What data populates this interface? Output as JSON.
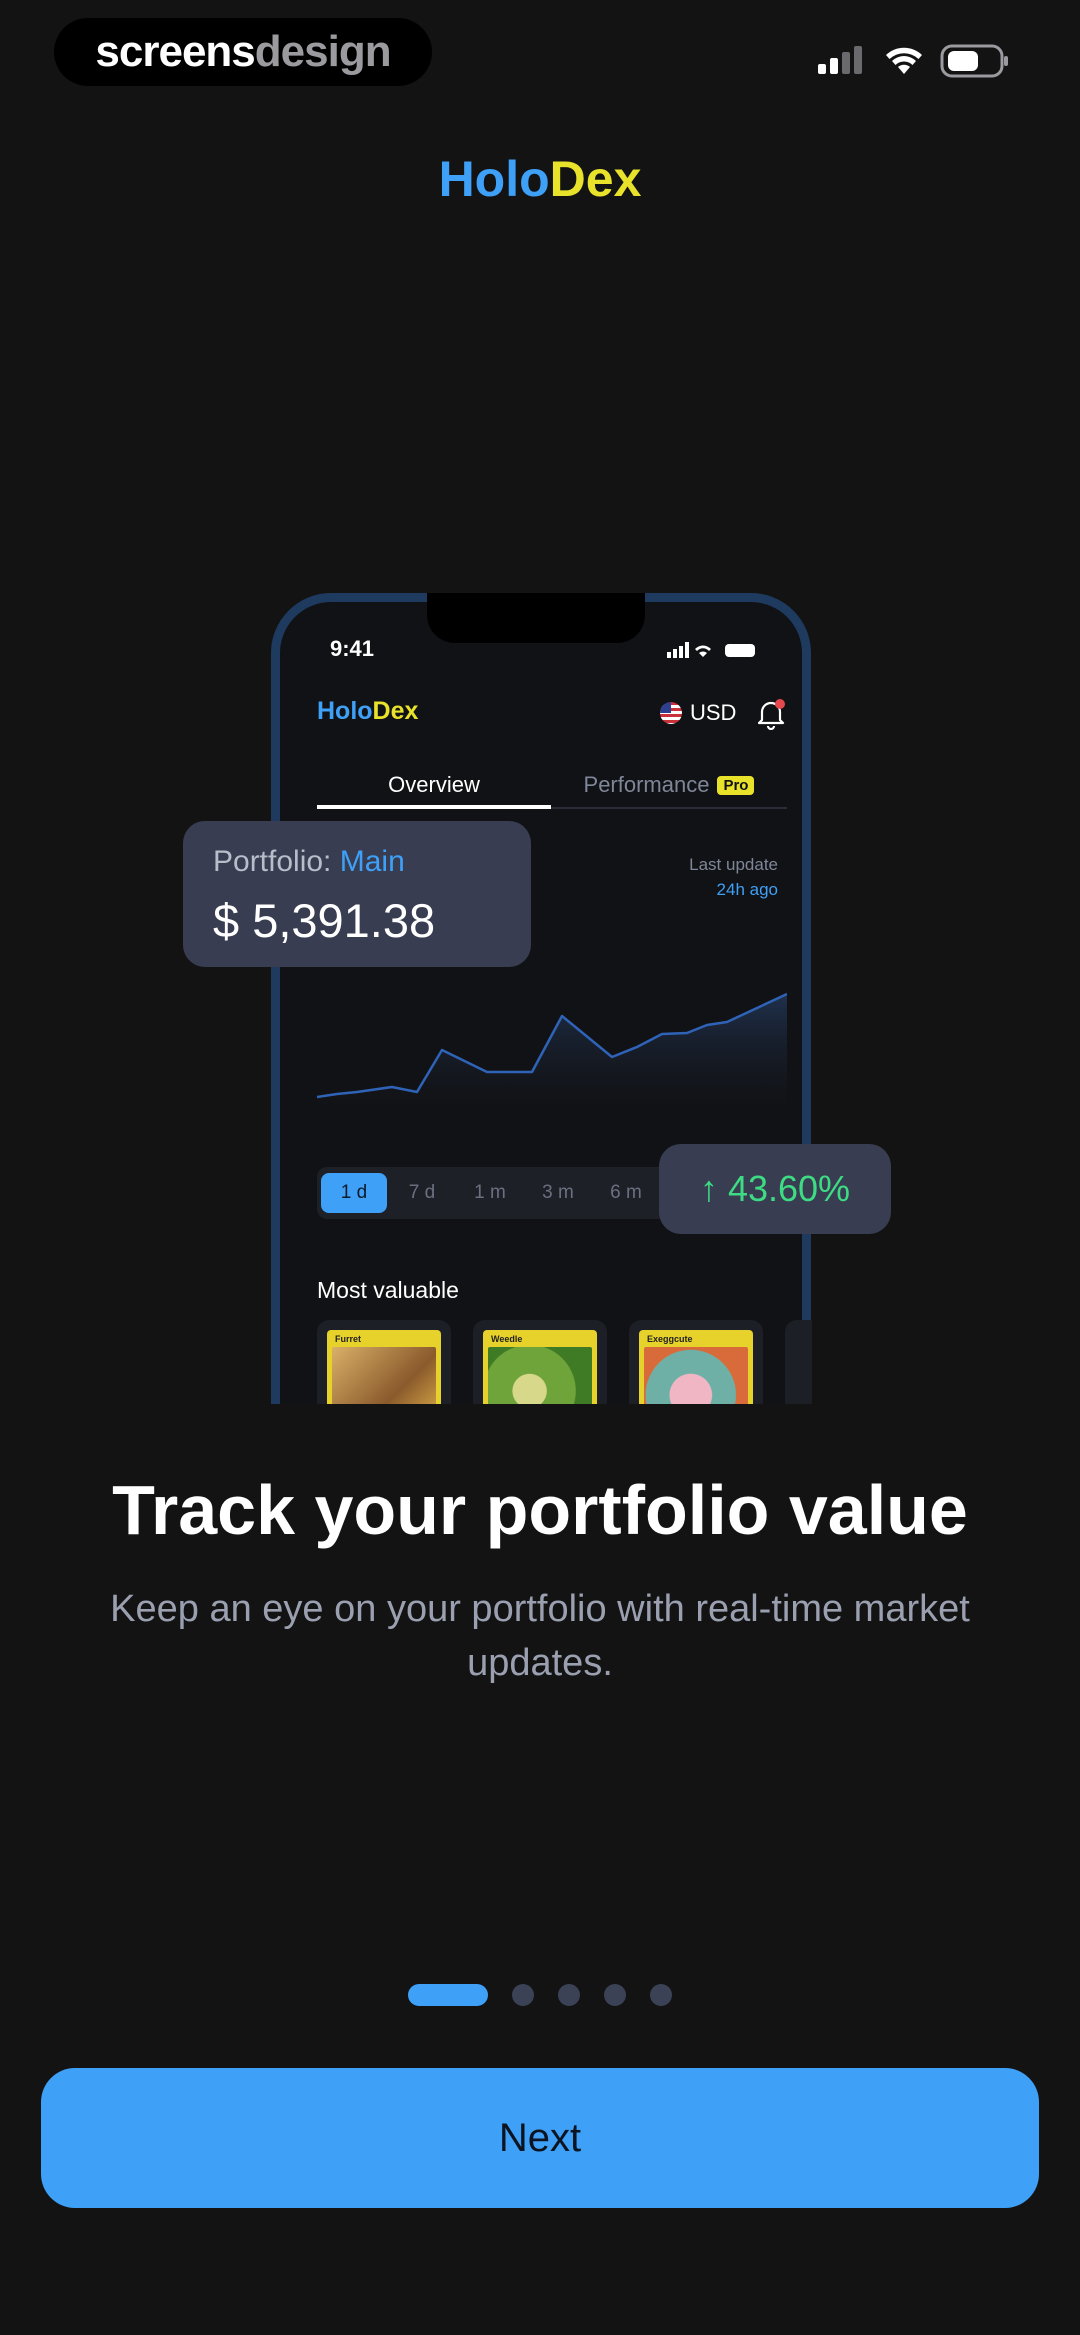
{
  "status_bar": {
    "watermark_part1": "screens",
    "watermark_part2": "design",
    "icons": [
      "signal-icon",
      "wifi-icon",
      "battery-icon"
    ]
  },
  "header": {
    "brand_holo": "Holo",
    "brand_dex": "Dex"
  },
  "mockup": {
    "time": "9:41",
    "brand_holo": "Holo",
    "brand_dex": "Dex",
    "currency": "USD",
    "tabs": [
      {
        "label": "Overview",
        "active": true
      },
      {
        "label": "Performance",
        "badge": "Pro",
        "active": false
      }
    ],
    "last_update_label": "Last update",
    "last_update_value": "24h ago",
    "ranges": [
      {
        "label": "1 d",
        "selected": true
      },
      {
        "label": "7 d",
        "selected": false
      },
      {
        "label": "1 m",
        "selected": false
      },
      {
        "label": "3 m",
        "selected": false
      },
      {
        "label": "6 m",
        "selected": false
      }
    ],
    "most_valuable_label": "Most valuable",
    "cards": [
      {
        "name": "Furret",
        "color": "#b98f54"
      },
      {
        "name": "Weedle",
        "color": "#6fa43b"
      },
      {
        "name": "Exeggcute",
        "color": "#6fb0a6"
      }
    ]
  },
  "portfolio": {
    "label": "Portfolio:",
    "name": "Main",
    "value": "$ 5,391.38"
  },
  "change": {
    "arrow": "↑",
    "value": "43.60%"
  },
  "onboarding": {
    "title": "Track your portfolio value",
    "subtitle": "Keep an eye on your portfolio with real-time market updates.",
    "page_index": 0,
    "page_count": 5,
    "next_label": "Next"
  },
  "colors": {
    "accent": "#3ea0f7",
    "brand_yellow": "#e8e22b",
    "positive": "#3ddc84",
    "background": "#131314"
  }
}
